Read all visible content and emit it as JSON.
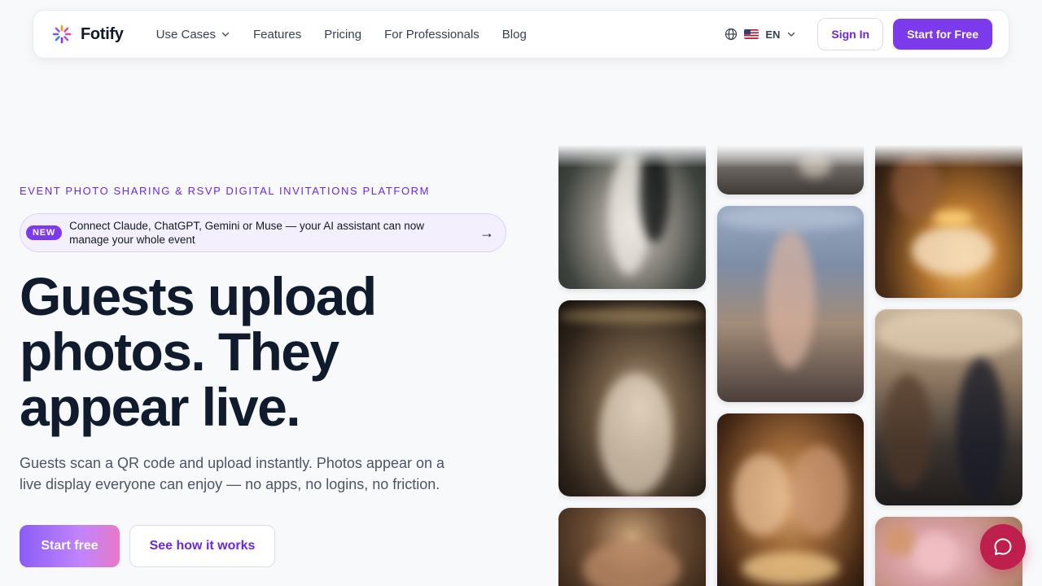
{
  "nav": {
    "brand": "Fotify",
    "links": [
      "Use Cases",
      "Features",
      "Pricing",
      "For Professionals",
      "Blog"
    ],
    "language": "EN",
    "sign_in": "Sign In",
    "start": "Start for Free"
  },
  "hero": {
    "eyebrow": "EVENT PHOTO SHARING & RSVP DIGITAL INVITATIONS PLATFORM",
    "badge": "NEW",
    "announcement": "Connect Claude, ChatGPT, Gemini or Muse — your AI assistant can now manage your whole event",
    "arrow": "→",
    "headline": "Guests upload photos. They appear live.",
    "subtext": "Guests scan a QR code and upload instantly. Photos appear on a live display everyone can enjoy — no apps, no logins, no friction.",
    "cta_primary": "Start free",
    "cta_secondary": "See how it works"
  },
  "photos": [
    {
      "name": "wedding-kiss-photo",
      "icon": "photo"
    },
    {
      "name": "guests-toast-photo",
      "icon": "photo"
    },
    {
      "name": "birthday-cake-photo",
      "icon": "photo"
    },
    {
      "name": "bride-dancing-photo",
      "icon": "photo"
    },
    {
      "name": "rooftop-dancer-photo",
      "icon": "photo"
    },
    {
      "name": "cocktail-party-photo",
      "icon": "photo"
    },
    {
      "name": "friends-hug-photo",
      "icon": "photo"
    },
    {
      "name": "champagne-cheers-photo",
      "icon": "photo"
    },
    {
      "name": "balloon-decor-photo",
      "icon": "photo"
    }
  ],
  "colors": {
    "accent": "#7c3aed",
    "chat": "#be1f4d",
    "heading": "#111b2e"
  }
}
